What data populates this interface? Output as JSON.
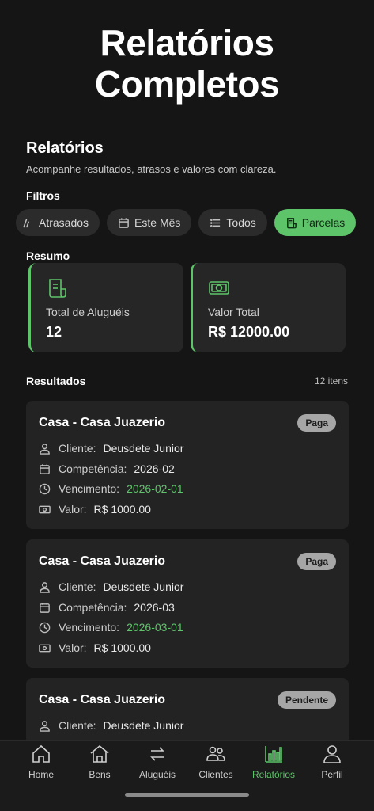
{
  "hero": {
    "line1": "Relatórios",
    "line2": "Completos"
  },
  "page": {
    "title": "Relatórios",
    "subtitle": "Acompanhe resultados, atrasos e valores com clareza."
  },
  "filters": {
    "label": "Filtros",
    "chips": [
      {
        "label": "Atrasados",
        "icon": "clock-partial-icon",
        "active": false
      },
      {
        "label": "Este Mês",
        "icon": "calendar-icon",
        "active": false
      },
      {
        "label": "Todos",
        "icon": "list-icon",
        "active": false
      },
      {
        "label": "Parcelas",
        "icon": "receipt-icon",
        "active": true
      }
    ]
  },
  "summary": {
    "label": "Resumo",
    "cards": [
      {
        "label": "Total de Aluguéis",
        "value": "12",
        "icon": "receipt-icon"
      },
      {
        "label": "Valor Total",
        "value": "R$ 12000.00",
        "icon": "cash-icon"
      }
    ]
  },
  "results": {
    "label": "Resultados",
    "count": "12 itens",
    "items": [
      {
        "title": "Casa - Casa Juazerio",
        "status": "Paga",
        "client_label": "Cliente:",
        "client": "Deusdete Junior",
        "competence_label": "Competência:",
        "competence": "2026-02",
        "due_label": "Vencimento:",
        "due": "2026-02-01",
        "value_label": "Valor:",
        "value": "R$ 1000.00"
      },
      {
        "title": "Casa - Casa Juazerio",
        "status": "Paga",
        "client_label": "Cliente:",
        "client": "Deusdete Junior",
        "competence_label": "Competência:",
        "competence": "2026-03",
        "due_label": "Vencimento:",
        "due": "2026-03-01",
        "value_label": "Valor:",
        "value": "R$ 1000.00"
      },
      {
        "title": "Casa - Casa Juazerio",
        "status": "Pendente",
        "client_label": "Cliente:",
        "client": "Deusdete Junior"
      }
    ]
  },
  "tabbar": {
    "tabs": [
      {
        "label": "Home",
        "icon": "home-icon",
        "active": false
      },
      {
        "label": "Bens",
        "icon": "house-icon",
        "active": false
      },
      {
        "label": "Aluguéis",
        "icon": "swap-icon",
        "active": false
      },
      {
        "label": "Clientes",
        "icon": "users-icon",
        "active": false
      },
      {
        "label": "Relatórios",
        "icon": "bar-chart-icon",
        "active": true
      },
      {
        "label": "Perfil",
        "icon": "user-icon",
        "active": false
      }
    ]
  },
  "colors": {
    "accent": "#5ec46a",
    "background": "#151515",
    "card": "#232323",
    "badge": "#a6a6a6"
  }
}
